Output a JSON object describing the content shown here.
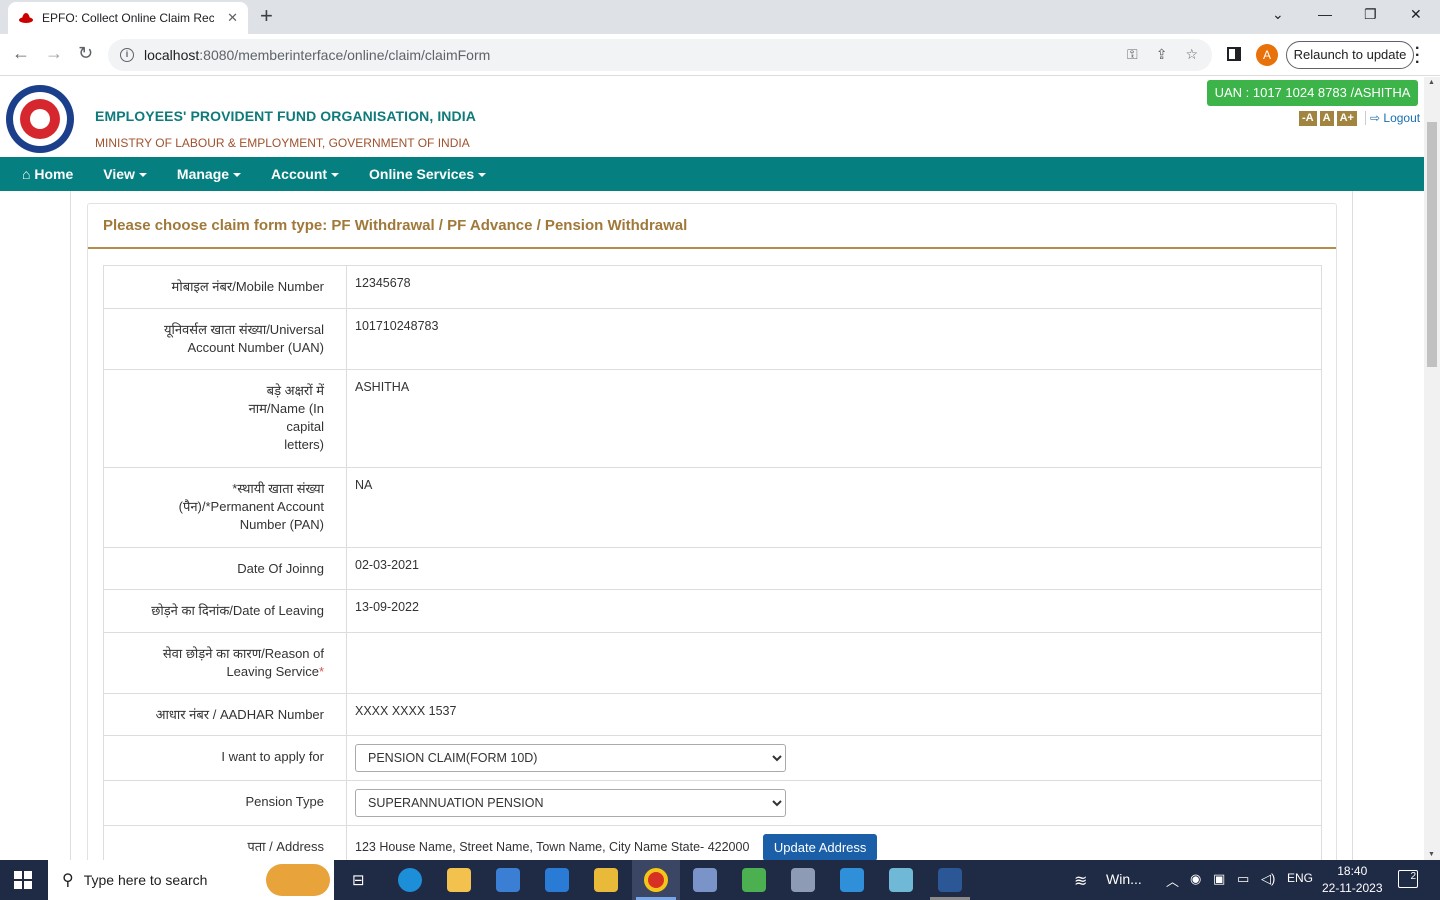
{
  "browser": {
    "tab_title": "EPFO: Collect Online Claim Rece",
    "tab_close": "✕",
    "new_tab": "+",
    "url_host": "localhost",
    "url_rest": ":8080/memberinterface/online/claim/claimForm",
    "profile_initial": "A",
    "relaunch_label": "Relaunch to update"
  },
  "header": {
    "org_name": "EMPLOYEES' PROVIDENT FUND ORGANISATION, INDIA",
    "ministry": "MINISTRY OF LABOUR & EMPLOYMENT, GOVERNMENT OF INDIA",
    "uan_badge": "UAN : 1017 1024 8783 /ASHITHA",
    "font_small": "-A",
    "font_normal": "A",
    "font_large": "A+",
    "logout": "Logout"
  },
  "nav": {
    "home": "Home",
    "view": "View",
    "manage": "Manage",
    "account": "Account",
    "online_services": "Online Services"
  },
  "panel": {
    "heading": "Please choose claim form type: PF Withdrawal / PF Advance / Pension Withdrawal"
  },
  "form": {
    "mobile_label": "मोबाइल नंबर/Mobile Number",
    "mobile_value": "12345678",
    "uan_label_1": "यूनिवर्सल खाता संख्या/Universal",
    "uan_label_2": "Account Number (UAN)",
    "uan_value": "101710248783",
    "name_label_1": "बड़े अक्षरों में",
    "name_label_2": "नाम/Name (In",
    "name_label_3": "capital",
    "name_label_4": "letters)",
    "name_value": "ASHITHA",
    "pan_label_1": "*स्थायी खाता संख्या",
    "pan_label_2": "(पैन)/*Permanent Account",
    "pan_label_3": "Number (PAN)",
    "pan_value": "NA",
    "doj_label": "Date Of Joinng",
    "doj_value": "02-03-2021",
    "dol_label": "छोड़ने का दिनांक/Date of Leaving",
    "dol_value": "13-09-2022",
    "reason_label_1": "सेवा छोड़ने का कारण/Reason of",
    "reason_label_2": "Leaving Service",
    "reason_required": "*",
    "aadhar_label": "आधार नंबर / AADHAR Number",
    "aadhar_value": "XXXX XXXX 1537",
    "apply_label": "I want to apply for",
    "apply_selected": "PENSION CLAIM(FORM 10D)",
    "pension_type_label": "Pension Type",
    "pension_type_selected": "SUPERANNUATION PENSION",
    "address_label": "पता / Address",
    "address_value": "123 House Name, Street Name, Town Name, City Name State- 422000",
    "update_address": "Update Address"
  },
  "taskbar": {
    "search_placeholder": "Type here to search",
    "weather_label": "Win...",
    "lang": "ENG",
    "time": "18:40",
    "date": "22-11-2023",
    "notif_count": "2"
  }
}
